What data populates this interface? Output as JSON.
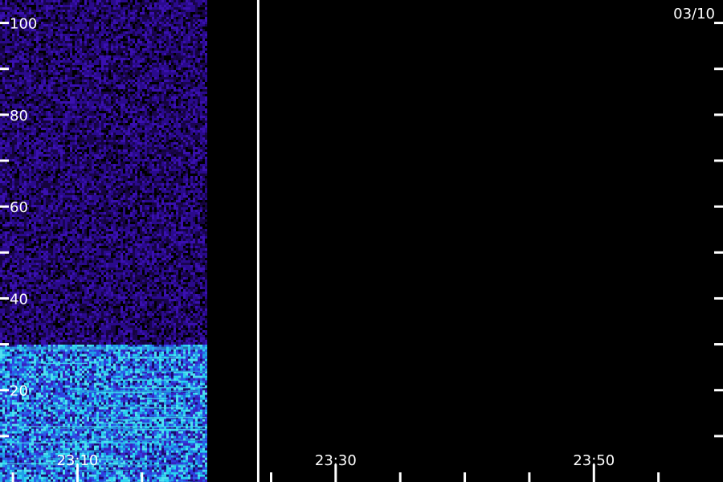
{
  "header": {
    "date": "03/10"
  },
  "chart_data": {
    "type": "heatmap",
    "title": "",
    "xlabel": "",
    "ylabel": "",
    "x_range": [
      "23:04",
      "24:00"
    ],
    "ylim": [
      0,
      105
    ],
    "y_ticks": [
      {
        "value": 10,
        "label": ""
      },
      {
        "value": 20,
        "label": "20"
      },
      {
        "value": 30,
        "label": ""
      },
      {
        "value": 40,
        "label": "40"
      },
      {
        "value": 50,
        "label": ""
      },
      {
        "value": 60,
        "label": "60"
      },
      {
        "value": 70,
        "label": ""
      },
      {
        "value": 80,
        "label": "80"
      },
      {
        "value": 90,
        "label": ""
      },
      {
        "value": 100,
        "label": "100"
      }
    ],
    "x_ticks": [
      {
        "value": "23:05",
        "label": ""
      },
      {
        "value": "23:10",
        "label": "23:10"
      },
      {
        "value": "23:15",
        "label": ""
      },
      {
        "value": "23:25",
        "label": ""
      },
      {
        "value": "23:30",
        "label": "23:30"
      },
      {
        "value": "23:35",
        "label": ""
      },
      {
        "value": "23:40",
        "label": ""
      },
      {
        "value": "23:45",
        "label": ""
      },
      {
        "value": "23:50",
        "label": "23:50"
      },
      {
        "value": "23:55",
        "label": ""
      }
    ],
    "data_end_time": "23:20",
    "current_time_marker": "23:24",
    "bands": [
      {
        "y_from": 0,
        "y_to": 30,
        "level": "high"
      },
      {
        "y_from": 30,
        "y_to": 105,
        "level": "low"
      }
    ],
    "colors": {
      "background": "#000000",
      "low": "#2a0a8c",
      "medium": "#2f3fe0",
      "high": "#28d4f0",
      "axis": "#ffffff"
    }
  }
}
